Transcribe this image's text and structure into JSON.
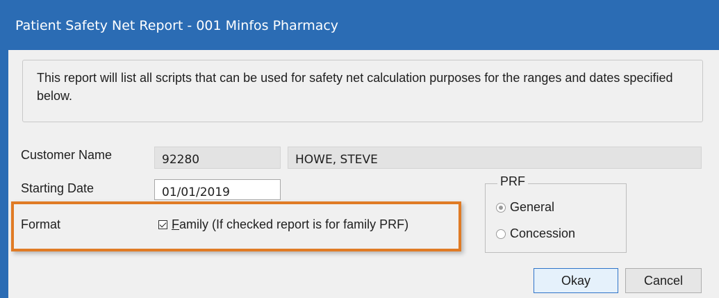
{
  "window": {
    "title": "Patient Safety Net Report - 001 Minfos Pharmacy"
  },
  "info": {
    "text": "This report will list all scripts that can be used for safety net calculation purposes for the ranges and dates specified below."
  },
  "form": {
    "customer_name_label": "Customer Name",
    "customer_code": "92280",
    "customer_name": "HOWE, STEVE",
    "starting_date_label": "Starting Date",
    "starting_date": "01/01/2019",
    "format_label": "Format",
    "family_checkbox": {
      "label_underlined": "F",
      "label_rest": "amily (If checked report is for family PRF)",
      "checked": true
    }
  },
  "prf": {
    "legend": "PRF",
    "options": [
      {
        "label": "General",
        "selected": true
      },
      {
        "label": "Concession",
        "selected": false
      }
    ]
  },
  "buttons": {
    "okay": "Okay",
    "cancel": "Cancel"
  },
  "colors": {
    "titlebar": "#2b6cb4",
    "highlight": "#e07b25"
  }
}
